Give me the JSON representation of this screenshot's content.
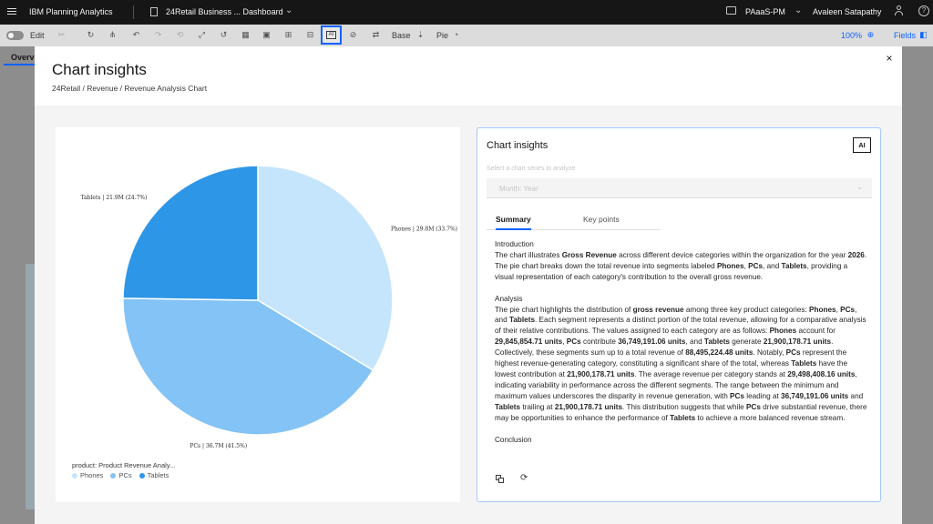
{
  "topbar": {
    "brand": "IBM Planning Analytics",
    "dashboard_title": "24Retail Business ... Dashboard",
    "environment": "PAaaS-PM",
    "user": "Avaleen Satapathy"
  },
  "toolbar": {
    "edit_label": "Edit",
    "base_label": "Base",
    "chart_type_label": "Pie",
    "zoom": "100%",
    "fields_label": "Fields"
  },
  "background": {
    "tab_label": "Overvi"
  },
  "modal": {
    "title": "Chart insights",
    "breadcrumb": "24Retail / Revenue / Revenue Analysis Chart",
    "close": "×"
  },
  "chart_data": {
    "type": "pie",
    "categories": [
      "Phones",
      "PCs",
      "Tablets"
    ],
    "values": [
      29.8,
      36.7,
      21.9
    ],
    "percentages": [
      33.7,
      41.5,
      24.7
    ],
    "slice_labels": [
      "Phones | 29.8M (33.7%)",
      "PCs | 36.7M (41.5%)",
      "Tablets | 21.9M (24.7%)"
    ],
    "colors": [
      "#c5e5fc",
      "#83c3f6",
      "#2e96e6"
    ],
    "legend_title": "product: Product Revenue Analy...",
    "legend_position": "bottom-left"
  },
  "insights": {
    "title": "Chart insights",
    "badge": "AI",
    "select_label": "Select a chart series to analyze",
    "select_value": "Month: Year",
    "tabs": [
      "Summary",
      "Key points"
    ],
    "sections": {
      "intro_heading": "Introduction",
      "intro": {
        "t1": "The chart illustrates ",
        "b1": "Gross Revenue",
        "t2": " across different device categories within the organization for the year ",
        "b2": "2026",
        "t3": ". The pie chart breaks down the total revenue into segments labeled ",
        "b3": "Phones",
        "t4": ", ",
        "b4": "PCs",
        "t5": ", and ",
        "b5": "Tablets",
        "t6": ", providing a visual representation of each category's contribution to the overall gross revenue."
      },
      "analysis_heading": "Analysis",
      "analysis": {
        "t1": "The pie chart highlights the distribution of ",
        "b1": "gross revenue",
        "t2": " among three key product categories: ",
        "b2": "Phones",
        "t3": ", ",
        "b3": "PCs",
        "t4": ", and ",
        "b4": "Tablets",
        "t5": ". Each segment represents a distinct portion of the total revenue, allowing for a comparative analysis of their relative contributions. The values assigned to each category are as follows: ",
        "b5": "Phones",
        "t6": " account for ",
        "b6": "29,845,854.71 units",
        "t7": ", ",
        "b7": "PCs",
        "t8": " contribute ",
        "b8": "36,749,191.06 units",
        "t9": ", and ",
        "b9": "Tablets",
        "t10": " generate ",
        "b10": "21,900,178.71 units",
        "t11": ". Collectively, these segments sum up to a total revenue of ",
        "b11": "88,495,224.48 units",
        "t12": ". Notably, ",
        "b12": "PCs",
        "t13": " represent the highest revenue-generating category, constituting a significant share of the total, whereas ",
        "b13": "Tablets",
        "t14": " have the lowest contribution at ",
        "b14": "21,900,178.71 units",
        "t15": ". The average revenue per category stands at ",
        "b15": "29,498,408.16 units",
        "t16": ", indicating variability in performance across the different segments. The range between the minimum and maximum values underscores the disparity in revenue generation, with ",
        "b16": "PCs",
        "t17": " leading at ",
        "b17": "36,749,191.06 units",
        "t18": " and ",
        "b18": "Tablets",
        "t19": " trailing at ",
        "b19": "21,900,178.71 units",
        "t20": ". This distribution suggests that while ",
        "b20": "PCs",
        "t21": " drive substantial revenue, there may be opportunities to enhance the performance of ",
        "b21": "Tablets",
        "t22": " to achieve a more balanced revenue stream."
      },
      "conclusion_heading": "Conclusion"
    }
  }
}
